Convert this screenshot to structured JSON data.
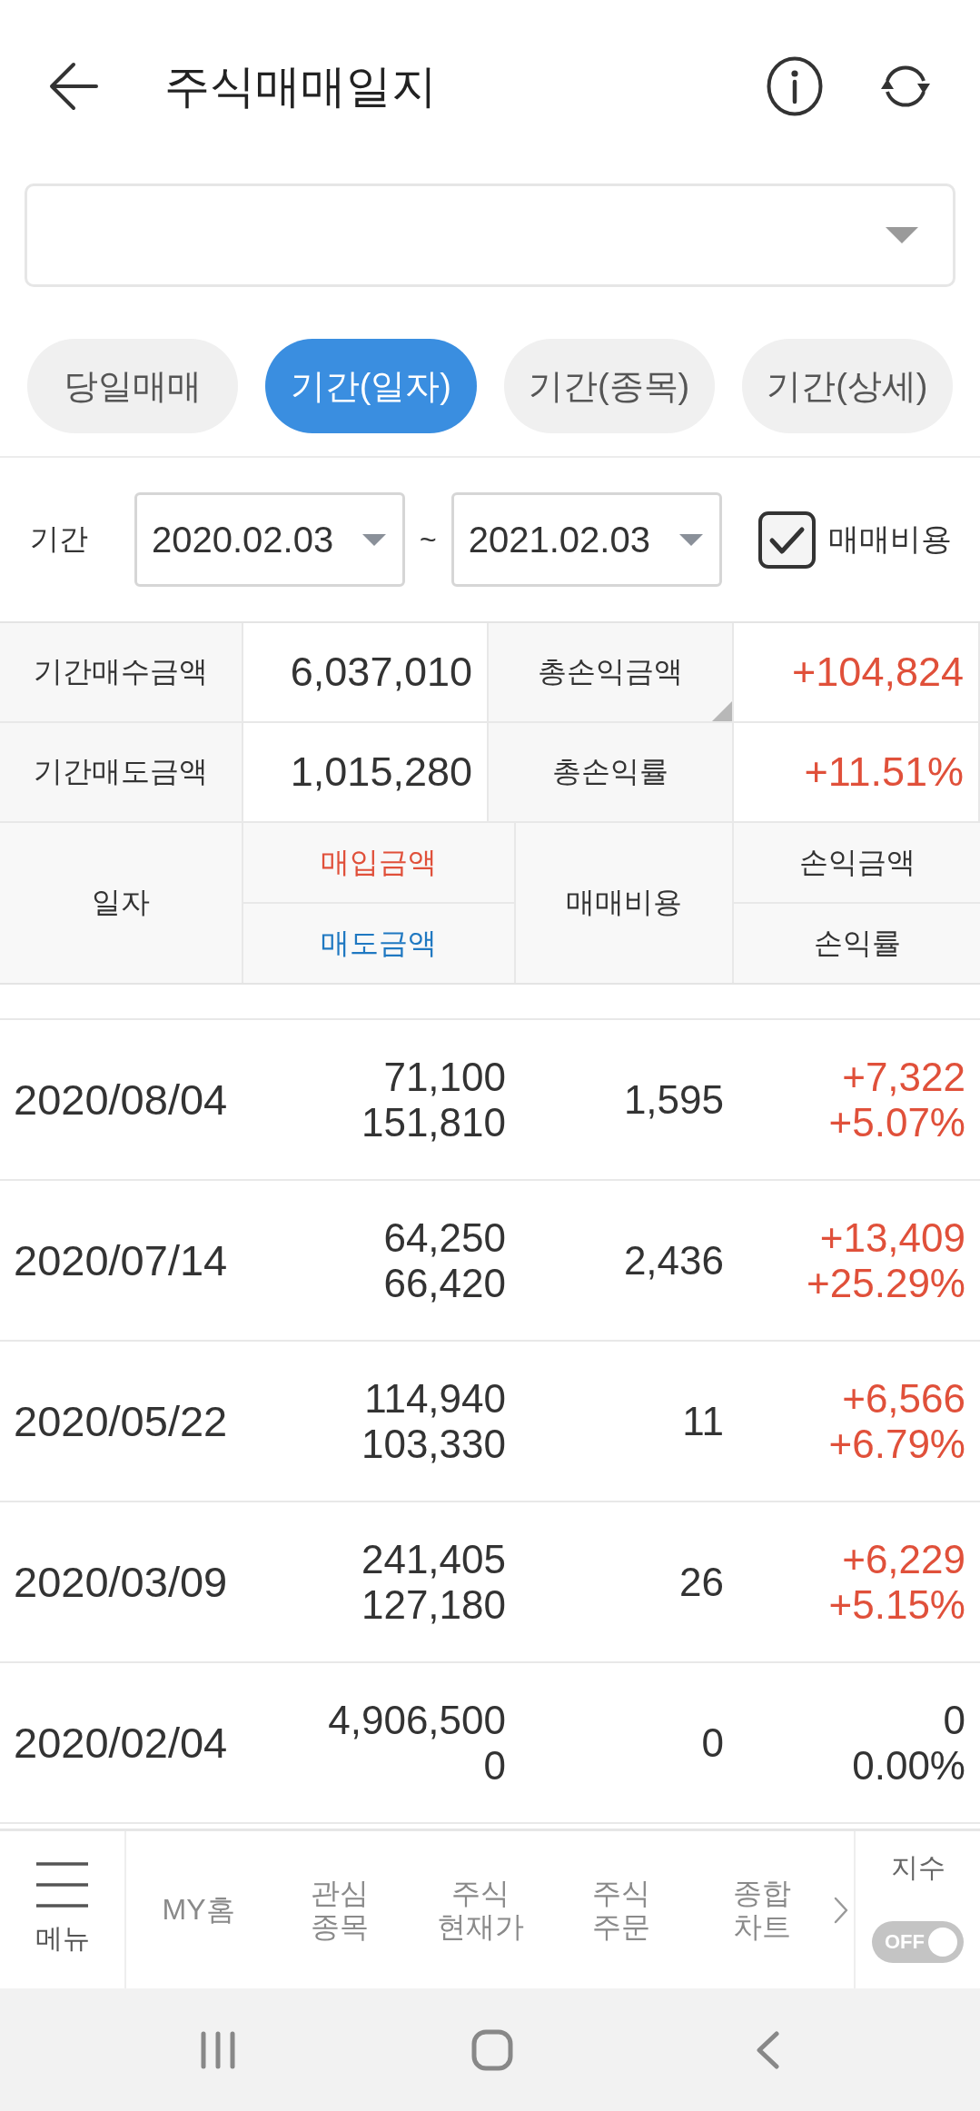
{
  "header": {
    "title": "주식매매일지"
  },
  "tabs": [
    {
      "label": "당일매매",
      "selected": false
    },
    {
      "label": "기간(일자)",
      "selected": true
    },
    {
      "label": "기간(종목)",
      "selected": false
    },
    {
      "label": "기간(상세)",
      "selected": false
    }
  ],
  "period": {
    "label": "기간",
    "start": "2020.02.03",
    "separator": "~",
    "end": "2021.02.03",
    "fee_checkbox": {
      "label": "매매비용",
      "checked": true
    }
  },
  "summary": [
    {
      "label": "기간매수금액",
      "value": "6,037,010",
      "color": "#333333",
      "corner_mark": false
    },
    {
      "label": "총손익금액",
      "value": "+104,824",
      "color": "#e0503a",
      "corner_mark": true
    },
    {
      "label": "기간매도금액",
      "value": "1,015,280",
      "color": "#333333",
      "corner_mark": false
    },
    {
      "label": "총손익률",
      "value": "+11.51%",
      "color": "#e0503a",
      "corner_mark": false
    }
  ],
  "table": {
    "columns": [
      {
        "labels": [
          {
            "text": "일자",
            "color": "#333333"
          }
        ]
      },
      {
        "labels": [
          {
            "text": "매입금액",
            "color": "#e0503a"
          },
          {
            "text": "매도금액",
            "color": "#1f78c1"
          }
        ]
      },
      {
        "labels": [
          {
            "text": "매매비용",
            "color": "#333333"
          }
        ]
      },
      {
        "labels": [
          {
            "text": "손익금액",
            "color": "#333333"
          },
          {
            "text": "손익률",
            "color": "#333333"
          }
        ]
      }
    ],
    "rows": [
      {
        "date": "2020/08/04",
        "buy": "71,100",
        "sell": "151,810",
        "fee": "1,595",
        "pnl": "+7,322",
        "rate": "+5.07%",
        "color": "#e0503a"
      },
      {
        "date": "2020/07/14",
        "buy": "64,250",
        "sell": "66,420",
        "fee": "2,436",
        "pnl": "+13,409",
        "rate": "+25.29%",
        "color": "#e0503a"
      },
      {
        "date": "2020/05/22",
        "buy": "114,940",
        "sell": "103,330",
        "fee": "11",
        "pnl": "+6,566",
        "rate": "+6.79%",
        "color": "#e0503a"
      },
      {
        "date": "2020/03/09",
        "buy": "241,405",
        "sell": "127,180",
        "fee": "26",
        "pnl": "+6,229",
        "rate": "+5.15%",
        "color": "#e0503a"
      },
      {
        "date": "2020/02/04",
        "buy": "4,906,500",
        "sell": "0",
        "fee": "0",
        "pnl": "0",
        "rate": "0.00%",
        "color": "#333333"
      }
    ]
  },
  "bottom_nav": {
    "menu_label": "메뉴",
    "items": [
      {
        "lines": [
          "MY홈"
        ]
      },
      {
        "lines": [
          "관심",
          "종목"
        ]
      },
      {
        "lines": [
          "주식",
          "현재가"
        ]
      },
      {
        "lines": [
          "주식",
          "주문"
        ]
      },
      {
        "lines": [
          "종합",
          "차트"
        ]
      }
    ],
    "index_toggle": {
      "label": "지수",
      "on": false,
      "state_text": "OFF"
    }
  }
}
